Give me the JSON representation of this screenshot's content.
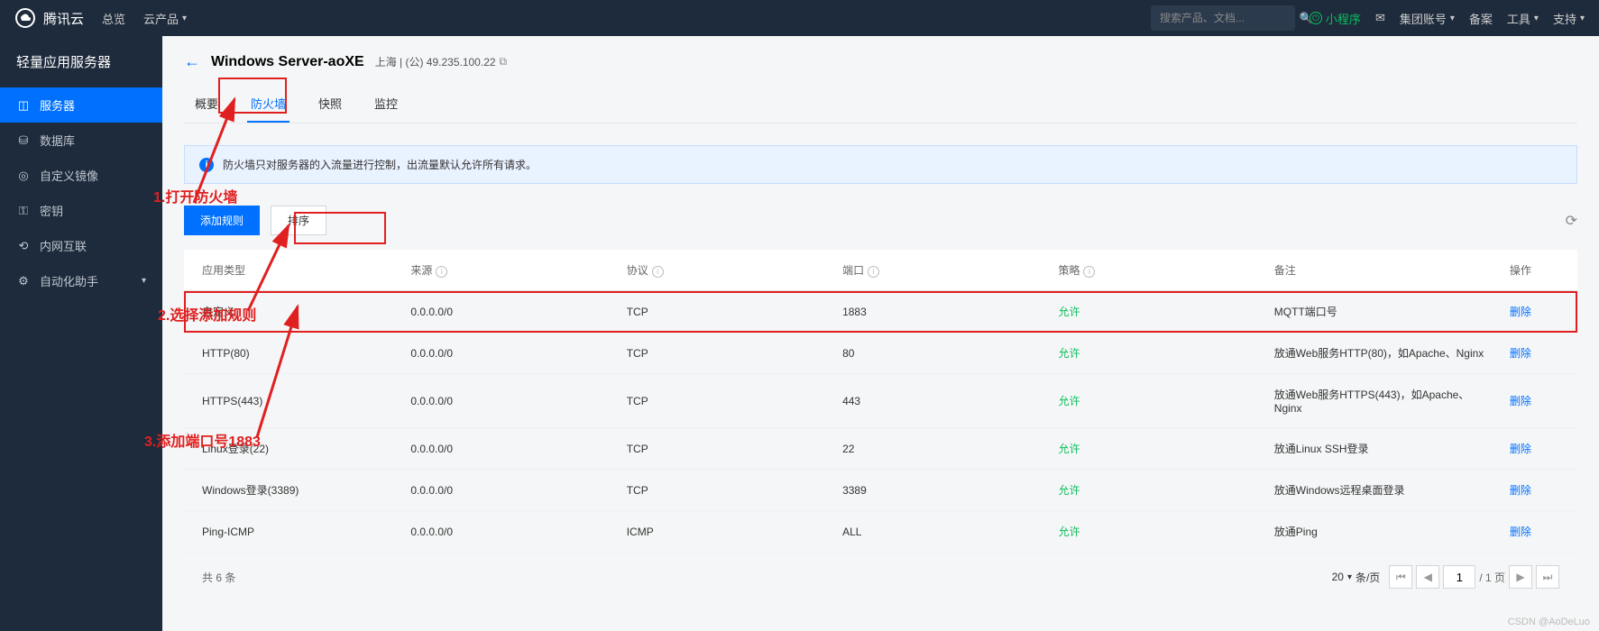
{
  "topbar": {
    "brand": "腾讯云",
    "overview": "总览",
    "products": "云产品",
    "search_placeholder": "搜索产品、文档...",
    "mini_program": "小程序",
    "mail_icon": "✉",
    "group_account": "集团账号",
    "beian": "备案",
    "tools": "工具",
    "support": "支持"
  },
  "sidebar": {
    "title": "轻量应用服务器",
    "items": [
      {
        "label": "服务器",
        "active": true
      },
      {
        "label": "数据库"
      },
      {
        "label": "自定义镜像"
      },
      {
        "label": "密钥"
      },
      {
        "label": "内网互联"
      },
      {
        "label": "自动化助手",
        "expandable": true
      }
    ]
  },
  "header": {
    "title": "Windows Server-aoXE",
    "region": "上海 | (公) 49.235.100.22"
  },
  "tabs": [
    "概要",
    "防火墙",
    "快照",
    "监控"
  ],
  "active_tab": 1,
  "banner": "防火墙只对服务器的入流量进行控制，出流量默认允许所有请求。",
  "buttons": {
    "add_rule": "添加规则",
    "sort": "排序"
  },
  "table": {
    "headers": [
      "应用类型",
      "来源",
      "协议",
      "端口",
      "策略",
      "备注",
      "操作"
    ],
    "rows": [
      {
        "app": "自定义",
        "source": "0.0.0.0/0",
        "proto": "TCP",
        "port": "1883",
        "policy": "允许",
        "note": "MQTT端口号",
        "action": "删除",
        "highlight": true
      },
      {
        "app": "HTTP(80)",
        "source": "0.0.0.0/0",
        "proto": "TCP",
        "port": "80",
        "policy": "允许",
        "note": "放通Web服务HTTP(80)，如Apache、Nginx",
        "action": "删除"
      },
      {
        "app": "HTTPS(443)",
        "source": "0.0.0.0/0",
        "proto": "TCP",
        "port": "443",
        "policy": "允许",
        "note": "放通Web服务HTTPS(443)，如Apache、Nginx",
        "action": "删除"
      },
      {
        "app": "Linux登录(22)",
        "source": "0.0.0.0/0",
        "proto": "TCP",
        "port": "22",
        "policy": "允许",
        "note": "放通Linux SSH登录",
        "action": "删除"
      },
      {
        "app": "Windows登录(3389)",
        "source": "0.0.0.0/0",
        "proto": "TCP",
        "port": "3389",
        "policy": "允许",
        "note": "放通Windows远程桌面登录",
        "action": "删除"
      },
      {
        "app": "Ping-ICMP",
        "source": "0.0.0.0/0",
        "proto": "ICMP",
        "port": "ALL",
        "policy": "允许",
        "note": "放通Ping",
        "action": "删除"
      }
    ]
  },
  "pagination": {
    "total_text": "共 6 条",
    "page_size": "20",
    "per_page_label": "条/页",
    "current": "1",
    "total_pages": "/ 1 页"
  },
  "annotations": {
    "a1": "1.打开防火墙",
    "a2": "2.选择添加规则",
    "a3": "3.添加端口号1883"
  },
  "watermark": "CSDN @AoDeLuo"
}
